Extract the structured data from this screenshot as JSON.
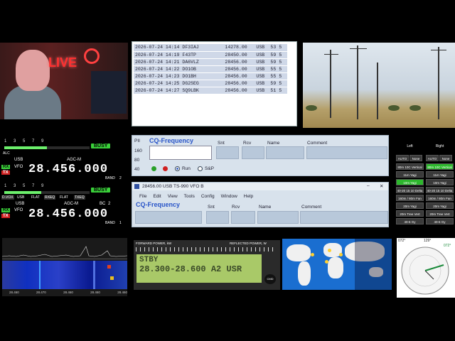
{
  "log": {
    "rows": [
      [
        "2026-07-24 14:14",
        "DF3IAJ",
        "14278.00",
        "USB",
        "53",
        "5"
      ],
      [
        "2026-07-24 14:19",
        "F43TP",
        "28450.00",
        "USB",
        "59",
        "5"
      ],
      [
        "2026-07-24 14:21",
        "DA6VLZ",
        "28456.00",
        "USB",
        "59",
        "5"
      ],
      [
        "2026-07-24 14:22",
        "DO1OB",
        "28456.00",
        "USB",
        "55",
        "5"
      ],
      [
        "2026-07-24 14:23",
        "DO1BH",
        "28456.00",
        "USB",
        "55",
        "5"
      ],
      [
        "2026-07-24 14:25",
        "DG2SEG",
        "28456.00",
        "USB",
        "59",
        "5"
      ],
      [
        "2026-07-24 14:27",
        "SQ9LBK",
        "28456.00",
        "USB",
        "51",
        "5"
      ]
    ]
  },
  "webcam": {
    "live_text": "LIVE"
  },
  "radio1": {
    "s_scale": "1 3 5 7 9",
    "alc": "ALC",
    "busy": "BUSY",
    "mode": "USB",
    "agc": "AGC-M",
    "rx": "RX",
    "tx": "TX",
    "vfo": "VFO",
    "freq": "28.456.000",
    "band": "BAND",
    "band_num": "2"
  },
  "radio2": {
    "s_scale": "1 3 5 7 9",
    "busy": "BUSY",
    "vox": "D.VOX",
    "mode": "USB",
    "flat1": "FLAT",
    "rx_eq": "RXEQ",
    "flat2": "FLAT",
    "tx_eq": "TXEQ",
    "mode2": "USB",
    "agc": "AGC-M",
    "bc": "BC",
    "bc_num": "2",
    "rx": "RX",
    "tx": "TX",
    "vfo": "VFO",
    "freq": "28.456.000",
    "band": "BAND",
    "band_num": "1"
  },
  "cq1": {
    "label_pi": "PII",
    "title": "CQ-Frequency",
    "cols": [
      "Snt",
      "Rcv",
      "Name",
      "Comment"
    ],
    "rows": [
      "160",
      "80",
      "40"
    ],
    "run": "Run",
    "sp": "S&P"
  },
  "cq2": {
    "title_bar": "28456.00 USB TS-990 VFO B",
    "menu": [
      "File",
      "Edit",
      "View",
      "Tools",
      "Config",
      "Window",
      "Help"
    ],
    "title": "CQ-Frequency",
    "cols": [
      "Snt",
      "Rcv",
      "Name",
      "Comment"
    ]
  },
  "bands": {
    "left_title": "Left",
    "right_title": "Right",
    "left": [
      "AUTO",
      "None",
      "80m 10C Vertical",
      "11m Yagi",
      "10m Yagi",
      "40-20 15 10 Delta",
      "160m / 80m Fan",
      "20m Yagi",
      "20m Tree Vert",
      "40-6 Gy"
    ],
    "right": [
      "AUTO",
      "None",
      "80m 10C Vertical",
      "11m Yagi",
      "10m Yagi",
      "40-20 15 10 Delta",
      "160m / 80m Fan",
      "20m Yagi",
      "20m Tree Vert",
      "40-6 Gy"
    ],
    "left_on": 4,
    "right_on": 2
  },
  "power": {
    "forward": "FORWARD POWER, kW",
    "reflected": "REFLECTED POWER, W",
    "line1": "28.300-28.600 A2 USR",
    "line2": "STBY",
    "btn": "CMD"
  },
  "rotator": {
    "label1": "072°",
    "label2": "129°",
    "label3": "072°"
  },
  "waterfall": {
    "ticks": [
      "28.460",
      "28.470",
      "28.460",
      "28.460",
      "28.460"
    ]
  }
}
